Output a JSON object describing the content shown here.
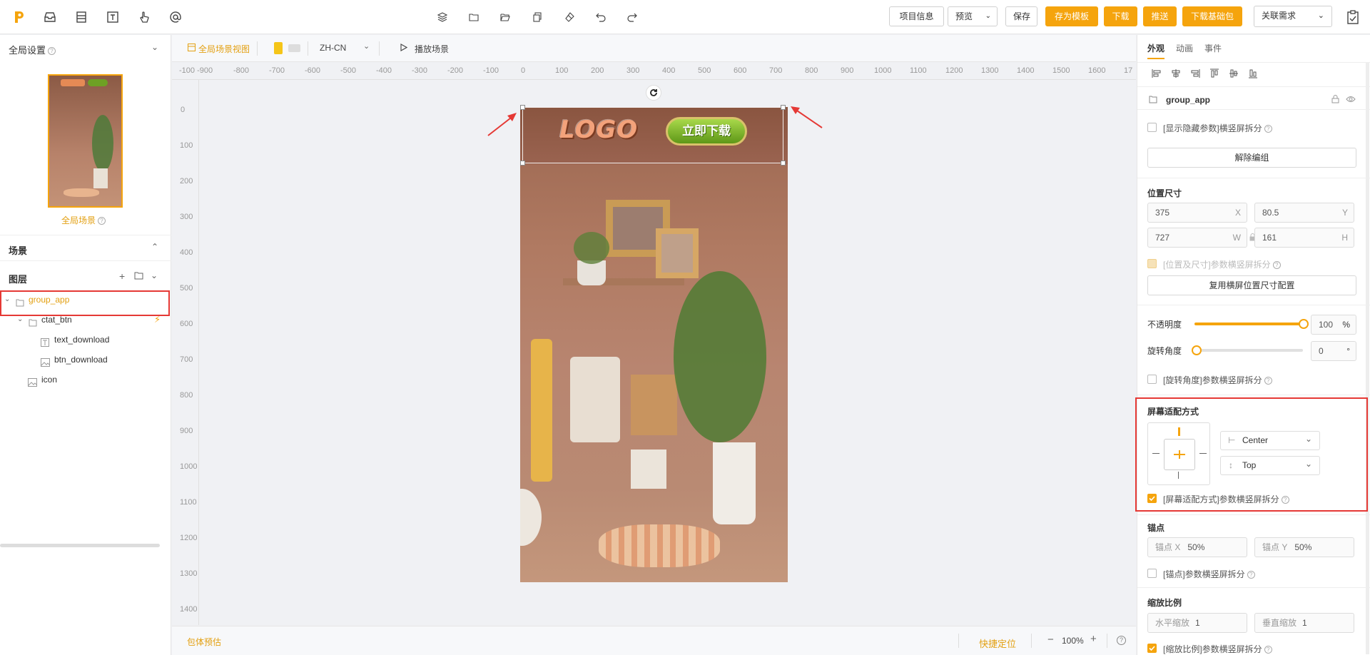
{
  "topbar": {
    "left_icons": [
      "logo-icon",
      "inbox-icon",
      "layout-icon",
      "text-icon",
      "hand-pointer-icon",
      "at-icon"
    ],
    "center_icons": [
      "layers-icon",
      "folder-icon",
      "folder-open-icon",
      "copy-icon",
      "eraser-icon",
      "undo-icon",
      "redo-icon"
    ],
    "project_info": "项目信息",
    "preview": "预览",
    "save": "保存",
    "save_template": "存为模板",
    "download": "下载",
    "push": "推送",
    "download_base": "下载基础包",
    "link_demand": "关联需求"
  },
  "left": {
    "global_settings": "全局设置",
    "global_scene": "全局场景",
    "scenes": "场景",
    "layers": "图层",
    "layer_tree": [
      {
        "name": "group_app",
        "type": "folder",
        "depth": 0,
        "selected": true
      },
      {
        "name": "ctat_btn",
        "type": "folder",
        "depth": 1,
        "lightning": true
      },
      {
        "name": "text_download",
        "type": "text",
        "depth": 2
      },
      {
        "name": "btn_download",
        "type": "image",
        "depth": 2
      },
      {
        "name": "icon",
        "type": "image",
        "depth": 1
      }
    ]
  },
  "canvas": {
    "global_view": "全局场景视图",
    "lang": "ZH-CN",
    "play_scene": "播放场景",
    "ruler_x": [
      "-100 -900",
      "-800",
      "-700",
      "-600",
      "-500",
      "-400",
      "-300",
      "-200",
      "-100",
      "0",
      "100",
      "200",
      "300",
      "400",
      "500",
      "600",
      "700",
      "800",
      "900",
      "1000",
      "1100",
      "1200",
      "1300",
      "1400",
      "1500",
      "1600",
      "17"
    ],
    "ruler_y": [
      "0",
      "100",
      "200",
      "300",
      "400",
      "500",
      "600",
      "700",
      "800",
      "900",
      "1000",
      "1100",
      "1200",
      "1300",
      "1400"
    ],
    "logo_text": "LOGO",
    "download_btn": "立即下载",
    "package_estimate": "包体预估",
    "quick_locate": "快捷定位",
    "zoom": "100%"
  },
  "right": {
    "tabs": [
      "外观",
      "动画",
      "事件"
    ],
    "active_tab": "外观",
    "group_name": "group_app",
    "show_hidden": "[显示隐藏参数]横竖屏拆分",
    "ungroup": "解除编组",
    "pos_size": "位置尺寸",
    "x_val": "375",
    "x_label": "X",
    "y_val": "80.5",
    "y_label": "Y",
    "w_val": "727",
    "w_label": "W",
    "h_val": "161",
    "h_label": "H",
    "pos_split": "[位置及尺寸]参数横竖屏拆分",
    "reuse_landscape": "复用横屏位置尺寸配置",
    "opacity_label": "不透明度",
    "opacity_val": "100",
    "opacity_unit": "%",
    "rotation_label": "旋转角度",
    "rotation_val": "0",
    "rotation_unit": "°",
    "rotation_split": "[旋转角度]参数横竖屏拆分",
    "screen_fit": "屏幕适配方式",
    "h_align": "Center",
    "v_align": "Top",
    "screen_fit_split": "[屏幕适配方式]参数横竖屏拆分",
    "anchor": "锚点",
    "anchor_x_label": "锚点 X",
    "anchor_x_val": "50%",
    "anchor_y_label": "锚点 Y",
    "anchor_y_val": "50%",
    "anchor_split": "[锚点]参数横竖屏拆分",
    "scale": "缩放比例",
    "scale_h_label": "水平缩放",
    "scale_h_val": "1",
    "scale_v_label": "垂直缩放",
    "scale_v_val": "1",
    "scale_split": "[缩放比例]参数横竖屏拆分"
  },
  "colors": {
    "accent": "#f5a40d",
    "annotation_red": "#e53935"
  }
}
